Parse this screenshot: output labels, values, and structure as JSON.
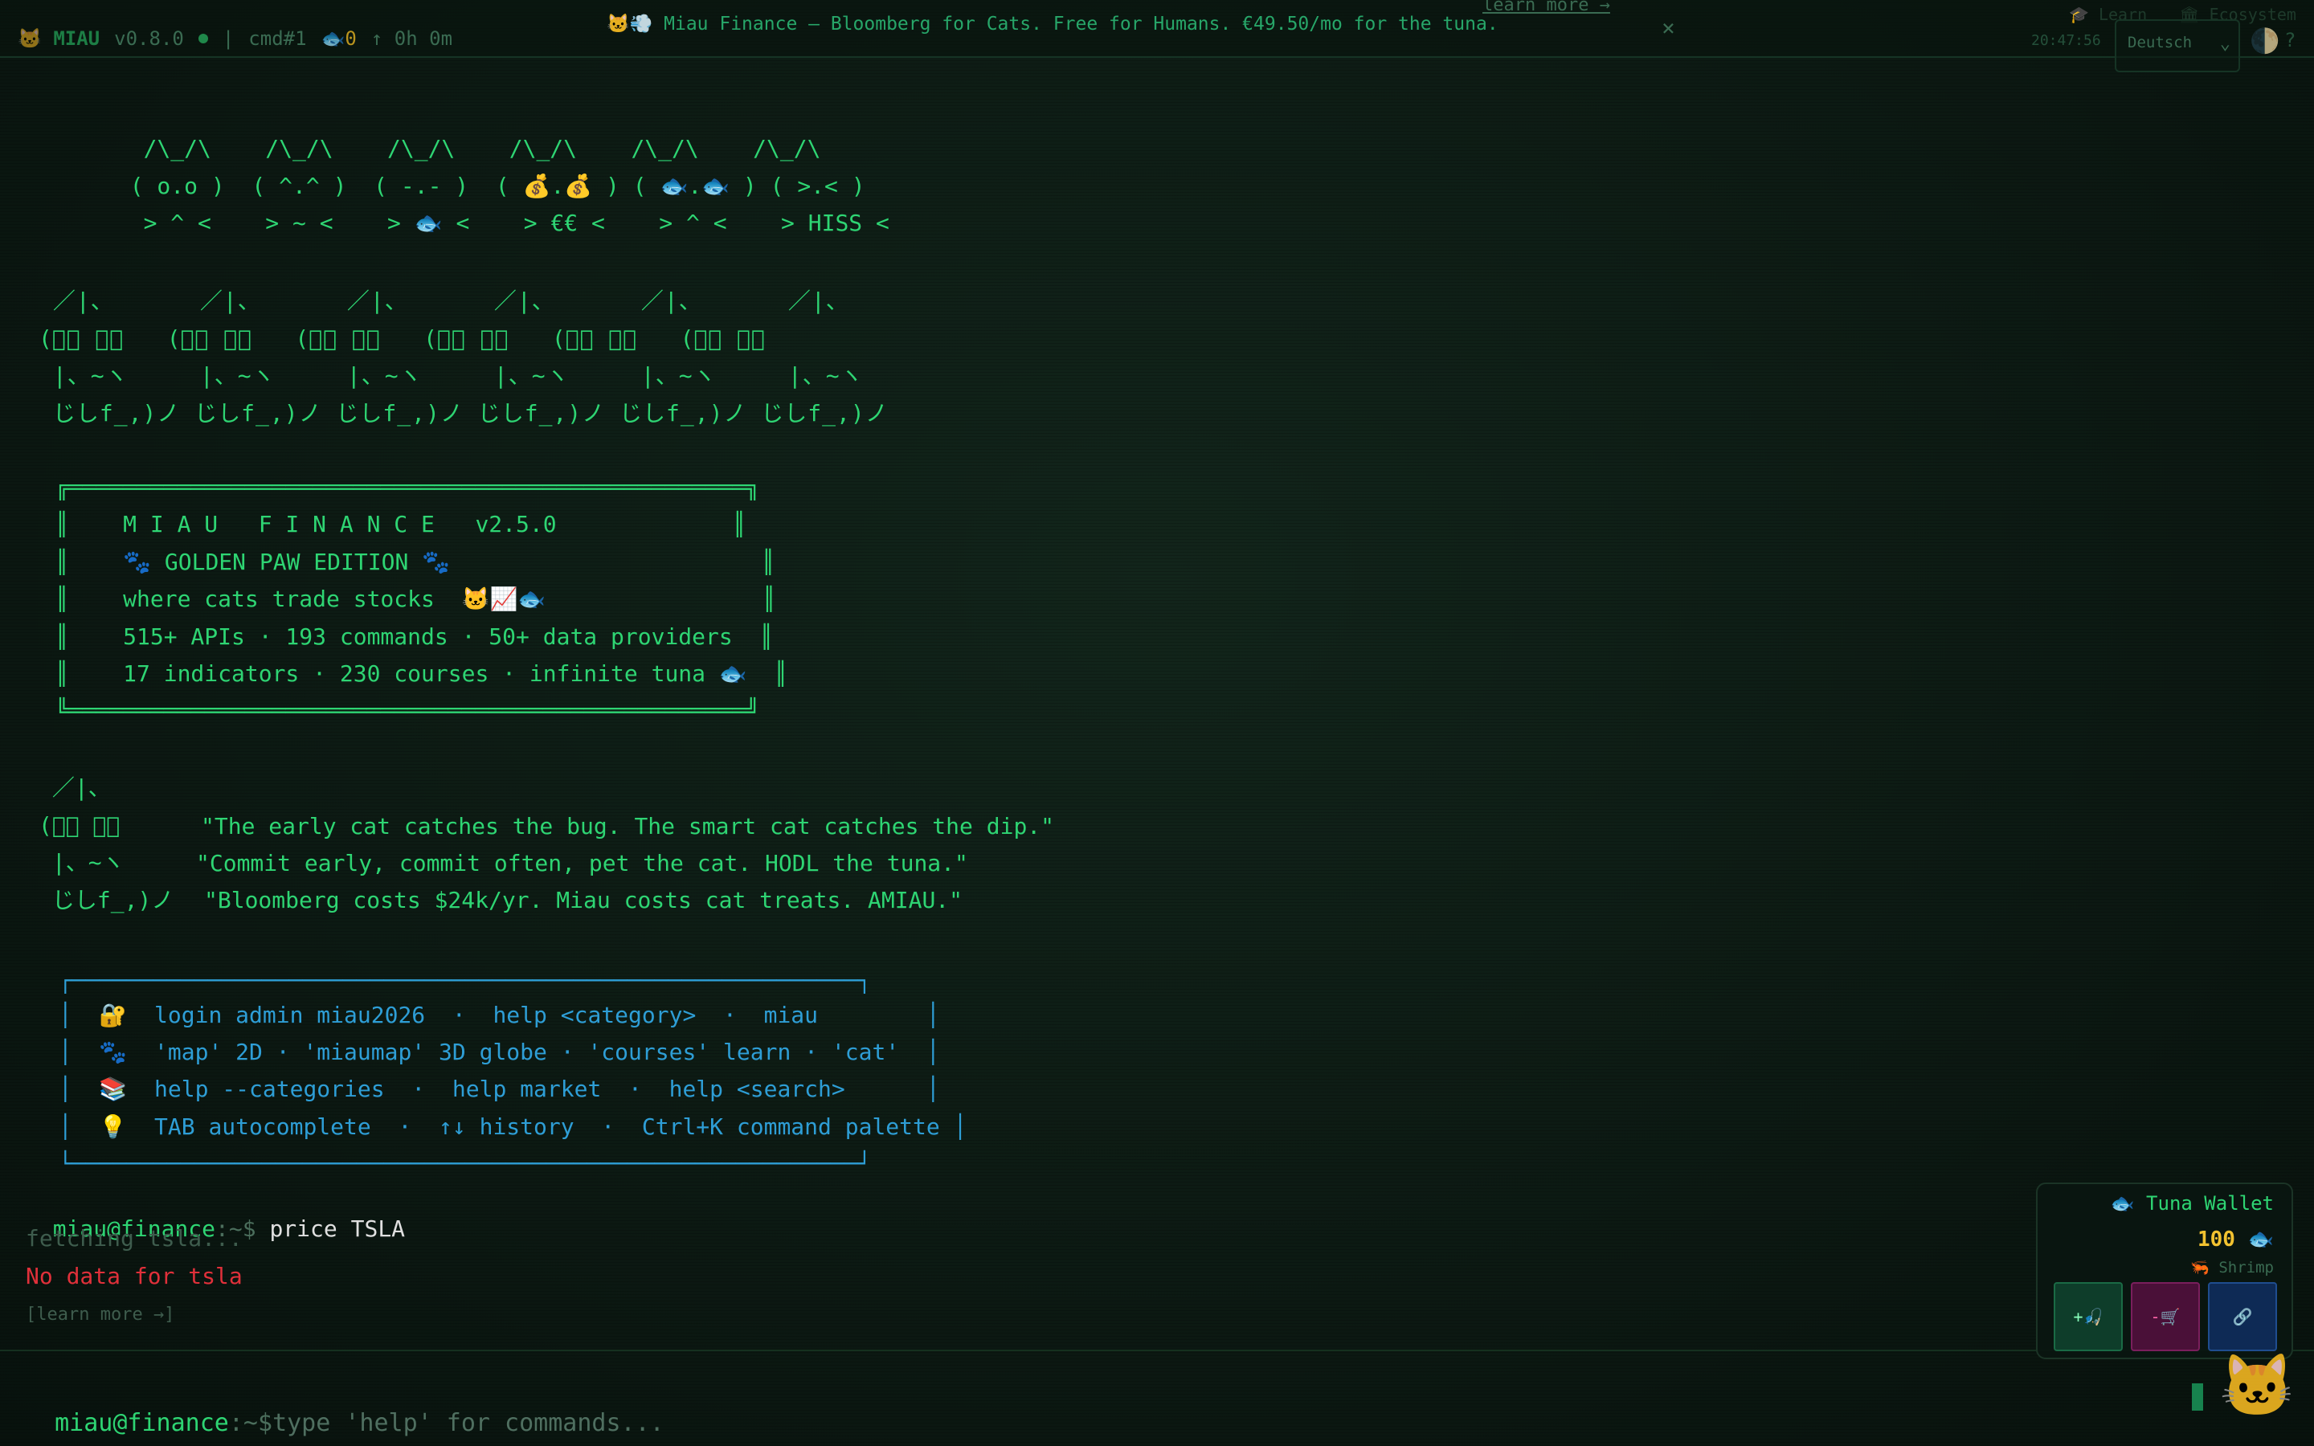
{
  "statusbar": {
    "brand": "🐱 MIAU",
    "version": "v0.8.0",
    "session": "cmd#1",
    "tuna": "🐟0",
    "uptime": "↑ 0h 0m",
    "banner": "🐱💨 Miau Finance — Bloomberg for Cats. Free for Humans. €49.50/mo for the tuna.",
    "learn_more": "learn more →",
    "close": "×",
    "links": [
      "🎓 Learn",
      "🏛 Ecosystem"
    ],
    "clock": "20:47:56",
    "language": "Deutsch",
    "help": "?"
  },
  "art": {
    "cats_small": "   /\\_/\\    /\\_/\\    /\\_/\\    /\\_/\\    /\\_/\\    /\\_/\\\n  ( o.o )  ( ^.^ )  ( -.- )  ( 💰.💰 ) ( 🐟.🐟 ) ( >.< )\n   > ^ <    > ~ <    > 🐟 <    > €€ <    > ^ <    > HISS <",
    "cats_kana": " ／|、      ／|、      ／|、      ／|、      ／|、      ／|、\n(ﾟ､ ｡７   (ﾟ､ ｡７   (ﾟ､ ｡７   (ﾟ､ ｡７   (ﾟ､ ｡７   (ﾟ､ ｡７\n |、~ヽ     |、~ヽ     |、~ヽ     |、~ヽ     |、~ヽ     |、~ヽ\n じしf_,)ノ じしf_,)ノ じしf_,)ノ じしf_,)ノ じしf_,)ノ じしf_,)ノ"
  },
  "title_box": {
    "top": " ╔══════════════════════════════════════════════════╗",
    "lines": [
      " ║    M I A U   F I N A N C E   v2.5.0             ║",
      " ║    🐾 GOLDEN PAW EDITION 🐾                       ║",
      " ║    where cats trade stocks  🐱📈🐟                ║",
      " ║    515+ APIs · 193 commands · 50+ data providers  ║",
      " ║    17 indicators · 230 courses · infinite tuna 🐟  ║"
    ],
    "bottom": " ╚══════════════════════════════════════════════════╝"
  },
  "quote_cat": " ／|、\n(ﾟ､ ｡７\n |、~ヽ\n じしf_,)ノ",
  "quotes": [
    "\"The early cat catches the bug. The smart cat catches the dip.\"",
    "\"Commit early, commit often, pet the cat. HODL the tuna.\"",
    "\"Bloomberg costs $24k/yr. Miau costs cat treats. AMIAU.\""
  ],
  "help_box": {
    "top": " ┌──────────────────────────────────────────────────────────┐",
    "lines": [
      " │  🔐  login admin miau2026  ·  help <category>  ·  miau        │",
      " │  🐾  'map' 2D · 'miaumap' 3D globe · 'courses' learn · 'cat'  │",
      " │  📚  help --categories  ·  help market  ·  help <search>      │",
      " │  💡  TAB autocomplete  ·  ↑↓ history  ·  Ctrl+K command palette │"
    ],
    "bottom": " └──────────────────────────────────────────────────────────┘"
  },
  "history": {
    "prompt_user": "miau@finance",
    "prompt_path": ":~$ ",
    "command": "price TSLA",
    "fetching": "fetching tsla...",
    "error": "No data for tsla",
    "learn": "[learn more →]"
  },
  "input": {
    "prompt_user": "miau@finance",
    "prompt_path": ":~$",
    "placeholder": "type 'help' for commands..."
  },
  "wallet": {
    "title": "🐟 Tuna Wallet",
    "amount": "100 🐟",
    "rank": "🦐 Shrimp",
    "buttons": [
      "+🎣",
      "-🛒",
      "🔗"
    ]
  },
  "colors": {
    "accent": "#2ed573",
    "help_cyan": "#2e9ed6",
    "error": "#e0303a",
    "gold": "#f2c230"
  }
}
